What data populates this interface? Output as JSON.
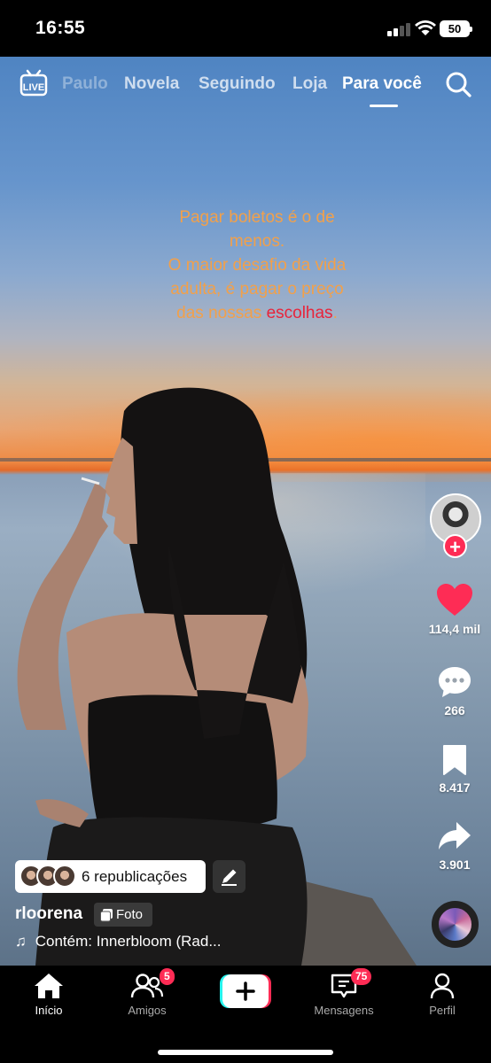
{
  "status_bar": {
    "time": "16:55",
    "battery": "50"
  },
  "top_nav": {
    "live_label": "LIVE",
    "tabs": [
      {
        "label": "Paulo"
      },
      {
        "label": "Novela"
      },
      {
        "label": "Seguindo"
      },
      {
        "label": "Loja"
      },
      {
        "label": "Para você"
      }
    ],
    "active_tab": "Para você"
  },
  "caption": {
    "line1": "Pagar boletos é o de",
    "line2": "menos.",
    "line3": "O maior desafio da vida",
    "line4": "adulta, é pagar o preço",
    "line5_prefix": "das nossas ",
    "line5_highlight": "escolhas",
    "line5_suffix": "."
  },
  "right_rail": {
    "likes": "114,4 mil",
    "comments": "266",
    "saves": "8.417",
    "shares": "3.901"
  },
  "post": {
    "reposts": "6 republicações",
    "username": "rloorena",
    "type_tag": "Foto",
    "sound": "Contém: Innerbloom (Rad..."
  },
  "bottom_nav": {
    "items": [
      {
        "label": "Início"
      },
      {
        "label": "Amigos",
        "badge": "5"
      },
      {
        "label": ""
      },
      {
        "label": "Mensagens",
        "badge": "75"
      },
      {
        "label": "Perfil"
      }
    ]
  },
  "colors": {
    "accent": "#fe2c55",
    "caption_text": "#f2a04a",
    "caption_highlight": "#e8243b"
  }
}
